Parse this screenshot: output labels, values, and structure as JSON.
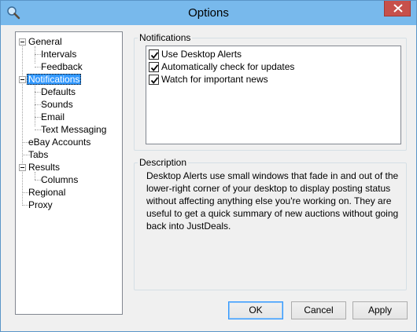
{
  "window": {
    "title": "Options"
  },
  "tree": {
    "items": [
      {
        "label": "General"
      },
      {
        "label": "Intervals"
      },
      {
        "label": "Feedback"
      },
      {
        "label": "Notifications",
        "selected": true
      },
      {
        "label": "Defaults"
      },
      {
        "label": "Sounds"
      },
      {
        "label": "Email"
      },
      {
        "label": "Text Messaging"
      },
      {
        "label": "eBay Accounts"
      },
      {
        "label": "Tabs"
      },
      {
        "label": "Results"
      },
      {
        "label": "Columns"
      },
      {
        "label": "Regional"
      },
      {
        "label": "Proxy"
      }
    ]
  },
  "notifications": {
    "legend": "Notifications",
    "options": [
      {
        "label": "Use Desktop Alerts",
        "checked": true
      },
      {
        "label": "Automatically check for updates",
        "checked": true
      },
      {
        "label": "Watch for important news",
        "checked": true
      }
    ]
  },
  "description": {
    "legend": "Description",
    "lines": [
      "Desktop Alerts use small windows that fade in and out of the",
      "lower-right corner of your desktop to display posting status",
      "without affecting anything else you're working on.  They are",
      "useful to get a quick summary of new auctions without going",
      "back into JustDeals."
    ]
  },
  "buttons": {
    "ok": "OK",
    "cancel": "Cancel",
    "apply": "Apply"
  },
  "icons": {
    "app": "magnifier-icon",
    "close": "close-icon"
  },
  "colors": {
    "titlebar": "#78b9ec",
    "close": "#c7504b",
    "selection": "#3399ff"
  }
}
